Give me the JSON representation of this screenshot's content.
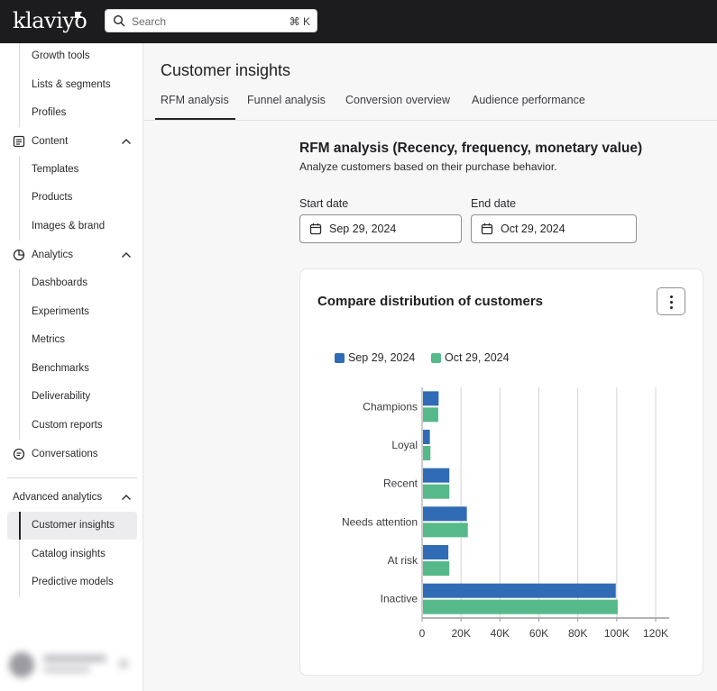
{
  "app": {
    "logo": "klaviyo"
  },
  "search": {
    "placeholder": "Search",
    "shortcut": "⌘ K"
  },
  "sidebar": {
    "items": [
      {
        "label": "Growth tools",
        "type": "sub"
      },
      {
        "label": "Lists & segments",
        "type": "sub"
      },
      {
        "label": "Profiles",
        "type": "sub"
      },
      {
        "label": "Content",
        "type": "top",
        "icon": "content-icon",
        "expanded": true
      },
      {
        "label": "Templates",
        "type": "sub"
      },
      {
        "label": "Products",
        "type": "sub"
      },
      {
        "label": "Images & brand",
        "type": "sub"
      },
      {
        "label": "Analytics",
        "type": "top",
        "icon": "analytics-icon",
        "expanded": true
      },
      {
        "label": "Dashboards",
        "type": "sub"
      },
      {
        "label": "Experiments",
        "type": "sub"
      },
      {
        "label": "Metrics",
        "type": "sub"
      },
      {
        "label": "Benchmarks",
        "type": "sub"
      },
      {
        "label": "Deliverability",
        "type": "sub"
      },
      {
        "label": "Custom reports",
        "type": "sub"
      },
      {
        "label": "Conversations",
        "type": "top",
        "icon": "conversations-icon"
      }
    ],
    "advanced": {
      "label": "Advanced analytics",
      "items": [
        "Customer insights",
        "Catalog insights",
        "Predictive models"
      ],
      "active": "Customer insights"
    }
  },
  "main": {
    "title": "Customer insights",
    "tabs": [
      "RFM analysis",
      "Funnel analysis",
      "Conversion overview",
      "Audience performance"
    ],
    "active_tab": "RFM analysis",
    "section_title": "RFM analysis (Recency, frequency, monetary value)",
    "section_subtitle": "Analyze customers based on their purchase behavior.",
    "start_label": "Start date",
    "start_value": "Sep 29, 2024",
    "end_label": "End date",
    "end_value": "Oct 29, 2024",
    "card_title": "Compare distribution of customers"
  },
  "colors": {
    "series1": "#2f6cb5",
    "series2": "#56b98a",
    "topbar": "#1c1c1e"
  },
  "chart_data": {
    "type": "bar",
    "orientation": "horizontal",
    "categories": [
      "Champions",
      "Loyal",
      "Recent",
      "Needs attention",
      "At risk",
      "Inactive"
    ],
    "series": [
      {
        "name": "Sep 29, 2024",
        "values": [
          8500,
          4000,
          14000,
          23000,
          13500,
          99500
        ]
      },
      {
        "name": "Oct 29, 2024",
        "values": [
          8300,
          4300,
          14000,
          23500,
          14000,
          100500
        ]
      }
    ],
    "xlim": [
      0,
      120000
    ],
    "xticks": [
      0,
      20000,
      40000,
      60000,
      80000,
      100000,
      120000
    ],
    "xtick_labels": [
      "0",
      "20K",
      "40K",
      "60K",
      "80K",
      "100K",
      "120K"
    ],
    "grid": true,
    "legend": "top-left"
  }
}
